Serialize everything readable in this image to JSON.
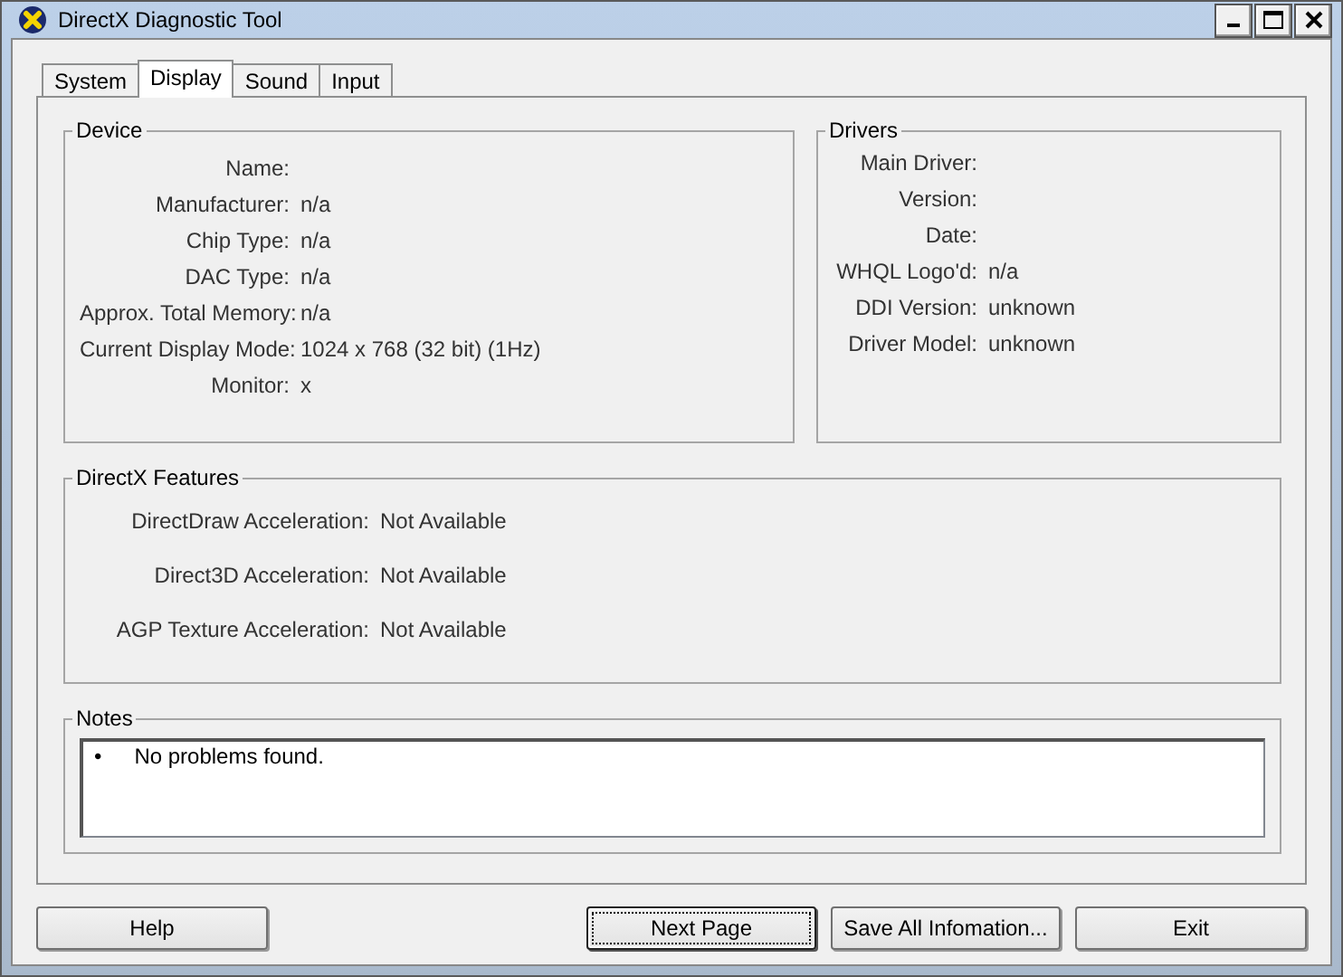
{
  "window": {
    "title": "DirectX Diagnostic Tool",
    "controls": [
      {
        "kind": "minimize"
      },
      {
        "kind": "maximize"
      },
      {
        "kind": "close"
      }
    ]
  },
  "tabs": [
    {
      "label": "System",
      "selected": false
    },
    {
      "label": "Display",
      "selected": true
    },
    {
      "label": "Sound",
      "selected": false
    },
    {
      "label": "Input",
      "selected": false
    }
  ],
  "device": {
    "title": "Device",
    "rows": [
      {
        "label": "Name:",
        "value": ""
      },
      {
        "label": "Manufacturer:",
        "value": "n/a"
      },
      {
        "label": "Chip Type:",
        "value": "n/a"
      },
      {
        "label": "DAC Type:",
        "value": "n/a"
      },
      {
        "label": "Approx. Total Memory:",
        "value": "n/a"
      },
      {
        "label": "Current Display Mode:",
        "value": "1024 x 768 (32 bit) (1Hz)"
      },
      {
        "label": "Monitor:",
        "value": "x"
      }
    ]
  },
  "drivers": {
    "title": "Drivers",
    "rows": [
      {
        "label": "Main Driver:",
        "value": ""
      },
      {
        "label": "Version:",
        "value": ""
      },
      {
        "label": "Date:",
        "value": ""
      },
      {
        "label": "WHQL Logo'd:",
        "value": "n/a"
      },
      {
        "label": "DDI Version:",
        "value": "unknown"
      },
      {
        "label": "Driver Model:",
        "value": "unknown"
      }
    ]
  },
  "features": {
    "title": "DirectX Features",
    "rows": [
      {
        "label": "DirectDraw Acceleration:",
        "value": "Not Available"
      },
      {
        "label": "Direct3D Acceleration:",
        "value": "Not Available"
      },
      {
        "label": "AGP Texture Acceleration:",
        "value": "Not Available"
      }
    ]
  },
  "notes": {
    "title": "Notes",
    "bullet": "•",
    "items": [
      "No problems found."
    ]
  },
  "buttons": [
    {
      "label": "Help",
      "focused": false
    },
    {
      "label": "Next Page",
      "focused": true
    },
    {
      "label": "Save All Infomation...",
      "focused": false
    },
    {
      "label": "Exit",
      "focused": false
    }
  ]
}
